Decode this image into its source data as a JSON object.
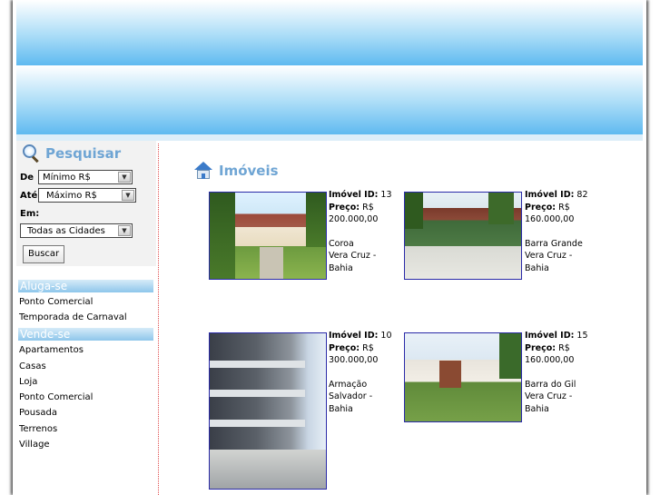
{
  "search": {
    "title": "Pesquisar",
    "de_label": "De",
    "de_value": "Mínimo R$",
    "ate_label": "Até",
    "ate_value": "Máximo R$",
    "em_label": "Em:",
    "city_value": "Todas as Cidades",
    "button_label": "Buscar"
  },
  "aluga": {
    "header": "Aluga-se",
    "items": [
      "Ponto Comercial",
      "Temporada de Carnaval"
    ]
  },
  "vende": {
    "header": "Vende-se",
    "items": [
      "Apartamentos",
      "Casas",
      "Loja",
      "Ponto Comercial",
      "Pousada",
      "Terrenos",
      "Village"
    ]
  },
  "main": {
    "title": "Imóveis",
    "id_label": "Imóvel ID:",
    "price_label": "Preço:",
    "properties": [
      {
        "id": "13",
        "currency": "R$",
        "price": "200.000,00",
        "place": "Coroa",
        "city": "Vera Cruz -",
        "state": "Bahia"
      },
      {
        "id": "82",
        "currency": "R$",
        "price": "160.000,00",
        "place": "Barra Grande",
        "city": "Vera Cruz -",
        "state": "Bahia"
      },
      {
        "id": "10",
        "currency": "R$",
        "price": "300.000,00",
        "place": "Armação",
        "city": "Salvador -",
        "state": "Bahia"
      },
      {
        "id": "15",
        "currency": "R$",
        "price": "160.000,00",
        "place": "Barra do Gil",
        "city": "Vera Cruz -",
        "state": "Bahia"
      }
    ]
  }
}
